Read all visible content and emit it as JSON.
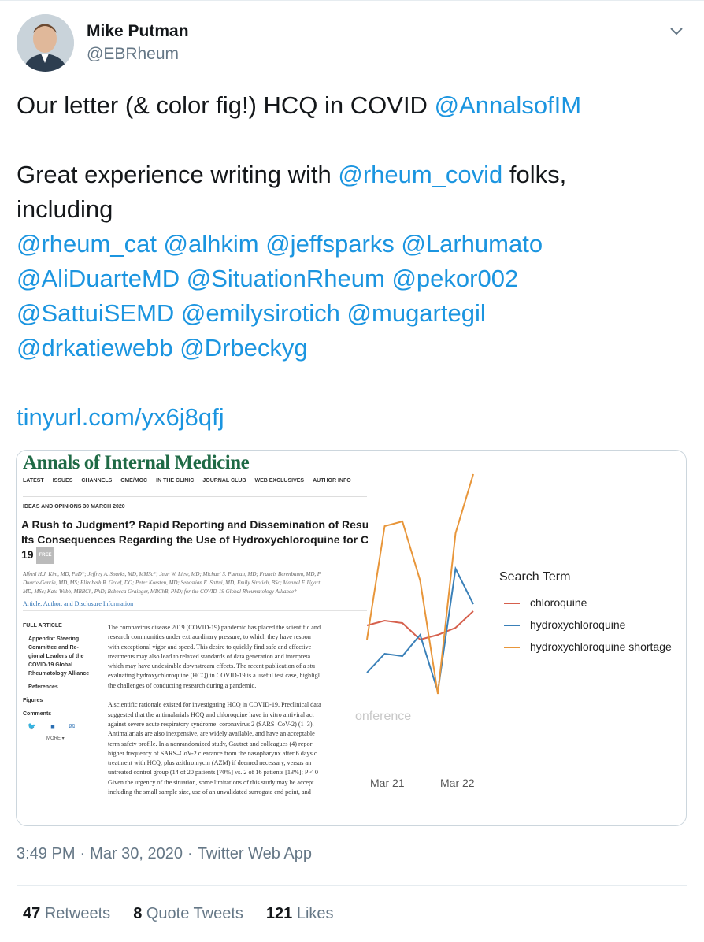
{
  "author": {
    "name": "Mike Putman",
    "handle": "@EBRheum"
  },
  "tweet": {
    "lines": [
      [
        {
          "t": "Our letter (& color fig!) HCQ in COVID ",
          "link": false
        },
        {
          "t": "@AnnalsofIM",
          "link": true
        }
      ],
      [],
      [
        {
          "t": "Great experience writing with ",
          "link": false
        },
        {
          "t": "@rheum_covid",
          "link": true
        },
        {
          "t": " folks,",
          "link": false
        }
      ],
      [
        {
          "t": "including",
          "link": false
        }
      ],
      [
        {
          "t": "@rheum_cat @alhkim @jeffsparks @Larhumato",
          "link": true
        }
      ],
      [
        {
          "t": "@AliDuarteMD @SituationRheum @pekor002",
          "link": true
        }
      ],
      [
        {
          "t": "@SattuiSEMD @emilysirotich @mugartegil",
          "link": true
        }
      ],
      [
        {
          "t": "@drkatiewebb @Drbeckyg",
          "link": true
        }
      ],
      [],
      [
        {
          "t": "tinyurl.com/yx6j8qfj",
          "link": true
        }
      ]
    ]
  },
  "journal": {
    "logo": "Annals of Internal Medicine",
    "nav": [
      "LATEST",
      "ISSUES",
      "CHANNELS",
      "CME/MOC",
      "IN THE CLINIC",
      "JOURNAL CLUB",
      "WEB EXCLUSIVES",
      "AUTHOR INFO"
    ],
    "section": "IDEAS AND OPINIONS   30 MARCH 2020",
    "title_line1": "A Rush to Judgment? Rapid Reporting and Dissemination of Results :",
    "title_line2": "Its Consequences Regarding the Use of Hydroxychloroquine for COVI",
    "title_line3": "19",
    "free": "FREE",
    "authors_line1": "Alfred H.J. Kim, MD, PhD*; Jeffrey A. Sparks, MD, MMSc*; Jean W. Liew, MD; Michael S. Putman, MD; Francis Berenbaum, MD, P",
    "authors_line2": "Duarte-García, MD, MS; Elizabeth R. Graef, DO; Peter Korsten, MD; Sebastian E. Sattui, MD; Emily Sirotich, BSc; Manuel F. Ugart",
    "authors_line3": "MD, MSc; Kate Webb, MBBCh, PhD; Rebecca Grainger, MBChB, PhD; for the COVID-19 Global Rheumatology Alliance†",
    "info_link": "Article, Author, and Disclosure Information",
    "side_heading": "FULL ARTICLE",
    "side_sub": "Appendix: Steering Committee and Re-gional Leaders of the COVID-19 Global Rheumatology Alliance",
    "side_items": [
      "References",
      "Figures",
      "Comments"
    ],
    "more": "MORE ▾",
    "body_lines": [
      "The coronavirus disease 2019 (COVID-19) pandemic has placed the scientific and",
      "research communities under extraordinary pressure, to which they have respon",
      "with exceptional vigor and speed. This desire to quickly find safe and effective",
      "treatments may also lead to relaxed standards of data generation and interpreta",
      "which may have undesirable downstream effects. The recent publication of a stu",
      "evaluating hydroxychloroquine (HCQ) in COVID-19 is a useful test case, highligl",
      "the challenges of conducting research during a pandemic.",
      "",
      "A scientific rationale existed for investigating HCQ in COVID-19. Preclinical data",
      "suggested that the antimalarials HCQ and chloroquine have in vitro antiviral act",
      "against severe acute respiratory syndrome–coronavirus 2 (SARS–CoV-2) (1–3).",
      "Antimalarials are also inexpensive, are widely available, and have an acceptable",
      "term safety profile. In a nonrandomized study, Gautret and colleagues (4) repor",
      "higher frequency of SARS–CoV-2 clearance from the nasopharynx after 6 days c",
      "treatment with HCQ, plus azithromycin (AZM) if deemed necessary, versus an",
      "untreated control group (14 of 20 patients [70%] vs. 2 of 16 patients [13%]; P < 0",
      "Given the urgency of the situation, some limitations of this study may be accept",
      "including the small sample size, use of an unvalidated surrogate end point, and"
    ]
  },
  "chart_data": {
    "type": "line",
    "legend_title": "Search Term",
    "x": [
      "",
      "",
      "Mar 21",
      "",
      "",
      "Mar 22",
      ""
    ],
    "tick_labels": [
      "Mar 21",
      "Mar 22"
    ],
    "ghost_text": "onference",
    "series": [
      {
        "name": "chloroquine",
        "color": "#d6604d",
        "values": [
          36,
          38,
          37,
          30,
          32,
          35,
          42
        ]
      },
      {
        "name": "hydroxychloroquine",
        "color": "#3a80b8",
        "values": [
          16,
          24,
          23,
          32,
          8,
          60,
          45
        ]
      },
      {
        "name": "hydroxychloroquine shortage",
        "color": "#e8963a",
        "values": [
          30,
          78,
          80,
          55,
          7,
          75,
          100
        ]
      }
    ],
    "ylim": [
      0,
      100
    ]
  },
  "meta": {
    "time": "3:49 PM",
    "date": "Mar 30, 2020",
    "client": "Twitter Web App"
  },
  "stats": [
    {
      "count": "47",
      "label": "Retweets"
    },
    {
      "count": "8",
      "label": "Quote Tweets"
    },
    {
      "count": "121",
      "label": "Likes"
    }
  ],
  "colors": {
    "link": "#1b95e0",
    "secondary": "#657786",
    "journal_green": "#1f6a45"
  }
}
